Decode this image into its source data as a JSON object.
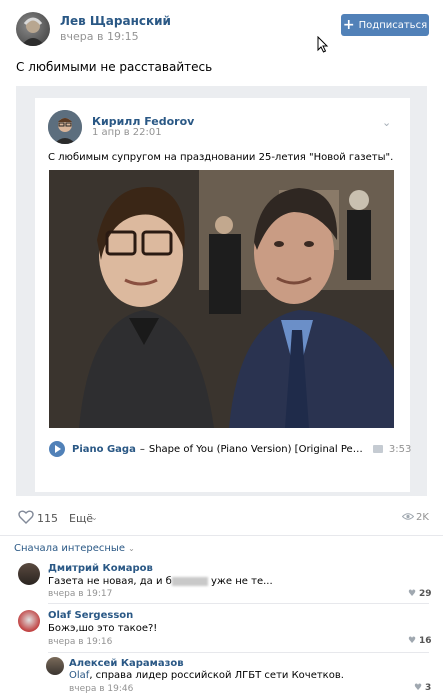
{
  "post": {
    "author": "Лев Щаранский",
    "time": "вчера в 19:15",
    "subscribe_label": "Подписаться",
    "text": "С любимыми не расставайтесь"
  },
  "repost": {
    "author": "Кирилл Fedorov",
    "date": "1 апр в 22:01",
    "text": "С любимым супругом на праздновании 25-летия \"Новой газеты\".",
    "audio": {
      "artist": "Piano Gaga",
      "separator": "–",
      "title": "Shape of You (Piano Version) [Original Performed by Ed...",
      "duration": "3:53"
    }
  },
  "actions": {
    "likes": "115",
    "more_label": "Ещё",
    "views": "2K"
  },
  "comments": {
    "sort_label": "Сначала интересные",
    "items": [
      {
        "author": "Дмитрий Комаров",
        "text_before": "Газета не новая, да и б",
        "text_after": " уже не те...",
        "time": "вчера в 19:17",
        "likes": "29"
      },
      {
        "author": "Olaf Sergesson",
        "text": "Божэ,шо это такое?!",
        "time": "вчера в 19:16",
        "likes": "16"
      },
      {
        "author": "Алексей Карамазов",
        "reply_to": "Olaf",
        "text": ", справа лидер российской ЛГБТ сети Кочетков.",
        "time": "вчера в 19:46",
        "likes": "3"
      }
    ]
  },
  "colors": {
    "accent": "#5181b8",
    "link": "#2a5885",
    "muted": "#939393",
    "card_bg": "#ebedf0"
  }
}
